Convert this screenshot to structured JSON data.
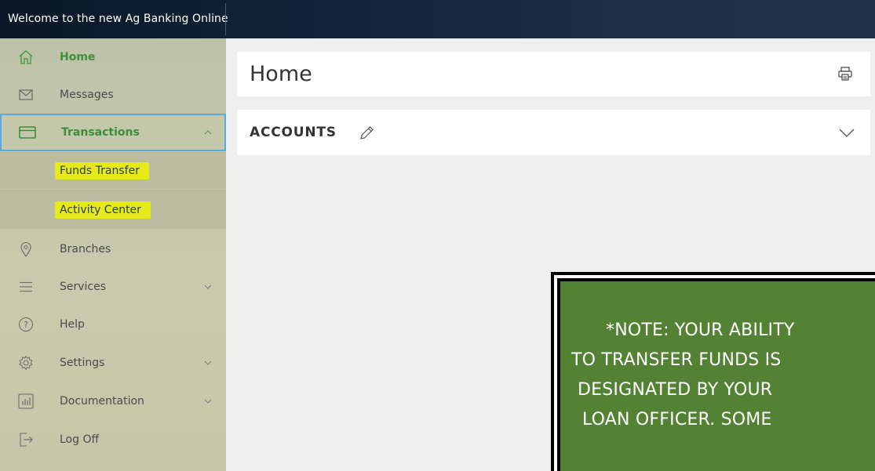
{
  "topbar": {
    "title": "Welcome to the new Ag Banking Online"
  },
  "sidebar": {
    "items": [
      {
        "label": "Home",
        "icon": "home-icon"
      },
      {
        "label": "Messages",
        "icon": "envelope-icon"
      },
      {
        "label": "Transactions",
        "icon": "card-icon"
      },
      {
        "label": "Branches",
        "icon": "location-pin-icon"
      },
      {
        "label": "Services",
        "icon": "menu-lines-icon"
      },
      {
        "label": "Help",
        "icon": "question-icon"
      },
      {
        "label": "Settings",
        "icon": "gear-icon"
      },
      {
        "label": "Documentation",
        "icon": "bar-chart-icon"
      },
      {
        "label": "Log Off",
        "icon": "logout-icon"
      }
    ],
    "sub_items": [
      {
        "label": "Funds Transfer"
      },
      {
        "label": "Activity Center"
      }
    ]
  },
  "main": {
    "page_title": "Home",
    "accounts_title": "ACCOUNTS"
  },
  "note": {
    "lines": [
      "*NOTE: YOUR ABILITY",
      "TO TRANSFER FUNDS IS",
      "DESIGNATED BY YOUR",
      "LOAN OFFICER. SOME"
    ]
  },
  "colors": {
    "accent_green": "#3f8f3a",
    "highlight_yellow": "#e6ea1a",
    "note_green": "#548235",
    "active_border": "#5aa9e0"
  }
}
